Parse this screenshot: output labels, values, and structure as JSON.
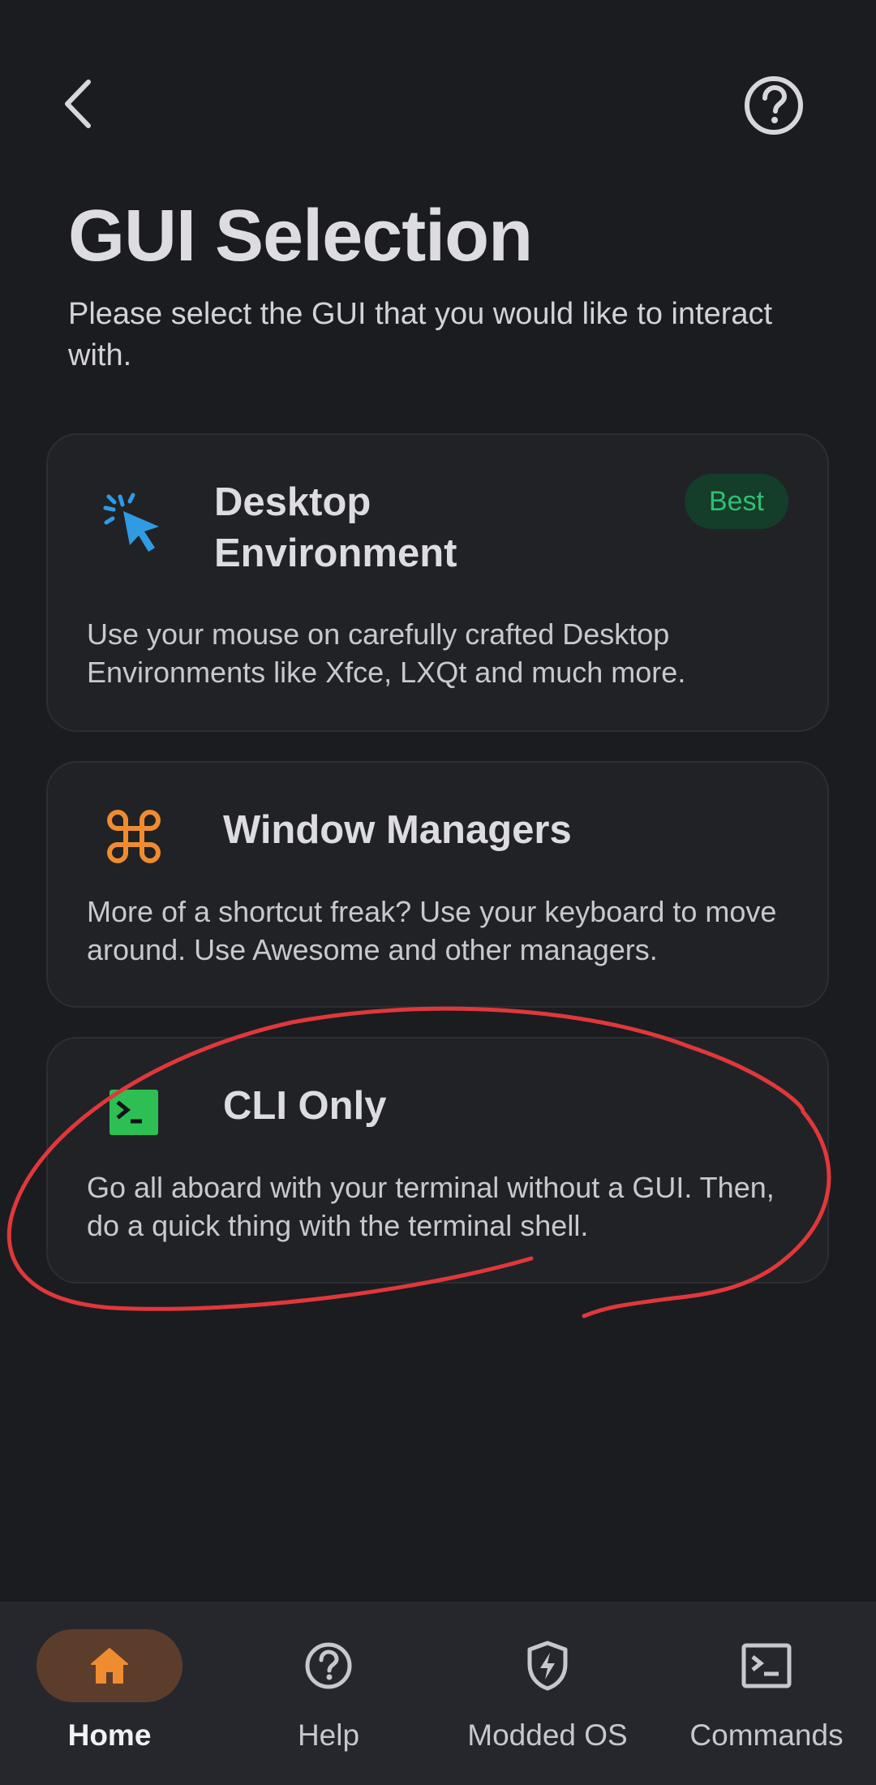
{
  "header": {
    "back_icon": "chevron-left-icon",
    "help_icon": "help-circle-icon"
  },
  "page": {
    "title": "GUI Selection",
    "subtitle": "Please select the GUI that you would like to interact with."
  },
  "options": [
    {
      "title": "Desktop Environment",
      "badge": "Best",
      "description": "Use your mouse on carefully crafted Desktop Environments like Xfce, LXQt and much more.",
      "icon": "cursor-click-icon",
      "icon_color": "#2f9be3"
    },
    {
      "title": "Window Managers",
      "description": "More of a shortcut freak? Use your keyboard to move around. Use Awesome and other managers.",
      "icon": "command-key-icon",
      "icon_color": "#f08c30"
    },
    {
      "title": "CLI Only",
      "description": "Go all aboard with your terminal without a GUI. Then, do a quick thing with the terminal shell.",
      "icon": "terminal-icon",
      "icon_color": "#2dbf54"
    }
  ],
  "bottom_nav": [
    {
      "label": "Home",
      "icon": "home-icon",
      "active": true
    },
    {
      "label": "Help",
      "icon": "help-circle-icon",
      "active": false
    },
    {
      "label": "Modded OS",
      "icon": "shield-bolt-icon",
      "active": false
    },
    {
      "label": "Commands",
      "icon": "terminal-icon",
      "active": false
    }
  ],
  "colors": {
    "background": "#1b1c20",
    "card": "#212226",
    "badge_bg": "#143d2a",
    "badge_text": "#2fbf71",
    "accent_orange": "#f08c30",
    "nav_active_pill": "#5c3d2c",
    "annotation_red": "#e0383a"
  }
}
